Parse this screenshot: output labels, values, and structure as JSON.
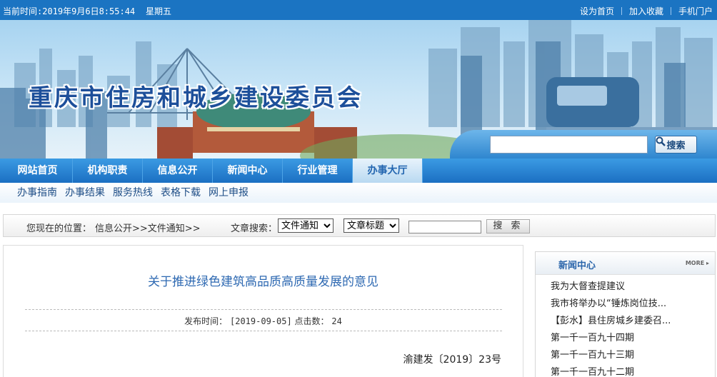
{
  "topbar": {
    "time": "当前时间:2019年9月6日8:55:44",
    "weekday": "星期五",
    "links": [
      "设为首页",
      "加入收藏",
      "手机门户"
    ]
  },
  "banner": {
    "site_title": "重庆市住房和城乡建设委员会",
    "search_button": "搜索"
  },
  "main_nav": {
    "items": [
      "网站首页",
      "机构职责",
      "信息公开",
      "新闻中心",
      "行业管理",
      "办事大厅"
    ],
    "active": "办事大厅"
  },
  "sub_nav": {
    "items": [
      "办事指南",
      "办事结果",
      "服务热线",
      "表格下载",
      "网上申报"
    ]
  },
  "location": {
    "label": "您现在的位置：",
    "path": "信息公开>>文件通知>>",
    "search_label": "文章搜索：",
    "category_select": "文件通知",
    "field_select": "文章标题",
    "search_button": "搜 索"
  },
  "article": {
    "title": "关于推进绿色建筑高品质高质量发展的意见",
    "meta_label_date": "发布时间：",
    "date": "[2019-09-05]",
    "meta_label_clicks": "点击数：",
    "clicks": "24",
    "doc_number": "渝建发〔2019〕23号"
  },
  "news_center": {
    "title": "新闻中心",
    "more": "MORE ▸",
    "items": [
      "我为大督查提建议",
      "我市将举办以“锤炼岗位技...",
      "【彭水】县住房城乡建委召...",
      "第一千一百九十四期",
      "第一千一百九十三期",
      "第一千一百九十二期"
    ]
  },
  "colors": {
    "topbar": "#1b74c2",
    "nav": "#1b6fc2",
    "title_blue": "#2e69b2"
  }
}
